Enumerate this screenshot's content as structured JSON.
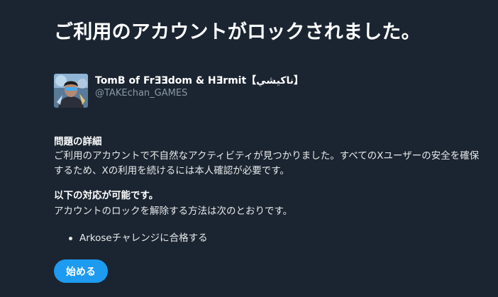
{
  "page": {
    "title": "ご利用のアカウントがロックされました。"
  },
  "account": {
    "display_name": "TomB of FrƎƎdom & HƎrmit【ناكيشي】",
    "handle": "@TAKEchan_GAMES",
    "avatar_icon": "user-avatar"
  },
  "details": {
    "heading": "問題の詳細",
    "body": "ご利用のアカウントで不自然なアクティビティが見つかりました。すべてのXユーザーの安全を確保するため、Xの利用を続けるには本人確認が必要です。"
  },
  "options": {
    "heading": "以下の対応が可能です。",
    "body": "アカウントのロックを解除する方法は次のとおりです。",
    "items": [
      "Arkoseチャレンジに合格する"
    ]
  },
  "actions": {
    "start_label": "始める"
  },
  "colors": {
    "background": "#1b2531",
    "text": "#ffffff",
    "muted": "#8b98a5",
    "accent": "#1d9bf0"
  }
}
